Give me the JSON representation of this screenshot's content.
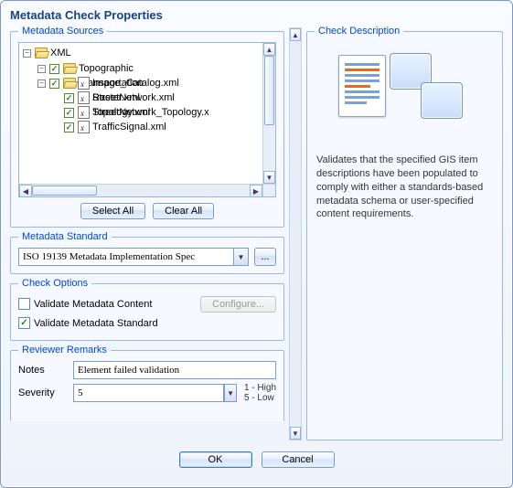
{
  "title": "Metadata Check Properties",
  "sources": {
    "legend": "Metadata Sources",
    "select_all": "Select All",
    "clear_all": "Clear All",
    "tree": {
      "root": "XML",
      "groups": [
        {
          "name": "Topographic",
          "items": [
            "Image_Catalog.xml",
            "Raster.xml",
            "Topology.xml"
          ]
        },
        {
          "name": "Transportation",
          "items": [
            "StreetNetwork.xml",
            "StreetNetwork_Topology.x",
            "TrafficSignal.xml"
          ]
        }
      ]
    }
  },
  "standard": {
    "legend": "Metadata Standard",
    "value": "ISO 19139 Metadata Implementation Spec",
    "more": "..."
  },
  "options": {
    "legend": "Check Options",
    "validate_content": {
      "label": "Validate Metadata Content",
      "checked": false
    },
    "validate_standard": {
      "label": "Validate Metadata Standard",
      "checked": true
    },
    "configure": "Configure..."
  },
  "remarks": {
    "legend": "Reviewer Remarks",
    "notes_label": "Notes",
    "notes_value": "Element failed validation",
    "severity_label": "Severity",
    "severity_value": "5",
    "severity_legend_high": "1 - High",
    "severity_legend_low": "5 - Low"
  },
  "description": {
    "legend": "Check Description",
    "text": "Validates that the specified GIS item descriptions have been populated to comply with either a standards-based metadata schema or user-specified content requirements."
  },
  "footer": {
    "ok": "OK",
    "cancel": "Cancel"
  },
  "glyph": {
    "check": "✓"
  }
}
